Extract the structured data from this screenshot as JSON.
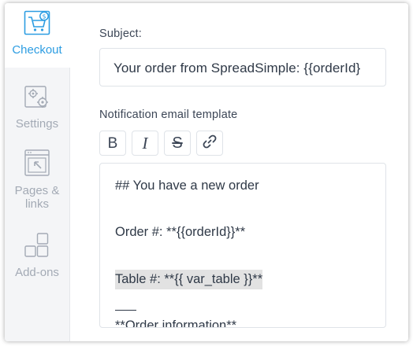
{
  "sidebar": {
    "items": [
      {
        "label": "Checkout",
        "icon": "cart-dollar-icon",
        "active": true
      },
      {
        "label": "Settings",
        "icon": "gears-icon",
        "active": false
      },
      {
        "label": "Pages & links",
        "label_line1": "Pages &",
        "label_line2": "links",
        "icon": "page-link-icon",
        "active": false
      },
      {
        "label": "Add-ons",
        "icon": "add-ons-icon",
        "active": false
      }
    ],
    "active_color": "#2d9de2",
    "inactive_color": "#a3aab5"
  },
  "subject": {
    "label": "Subject:",
    "value": "Your order from SpreadSimple: {{orderId}"
  },
  "template": {
    "label": "Notification email template",
    "toolbar": [
      {
        "label": "B",
        "icon": "bold-icon"
      },
      {
        "label": "I",
        "icon": "italic-icon"
      },
      {
        "label": "S",
        "icon": "strikethrough-icon"
      },
      {
        "label": "",
        "icon": "link-icon"
      }
    ],
    "lines": {
      "heading": "## You have a new order",
      "order": "Order #:  **{{orderId}}**",
      "table": "Table #: **{{ var_table }}**",
      "order_info": "**Order information**"
    }
  }
}
